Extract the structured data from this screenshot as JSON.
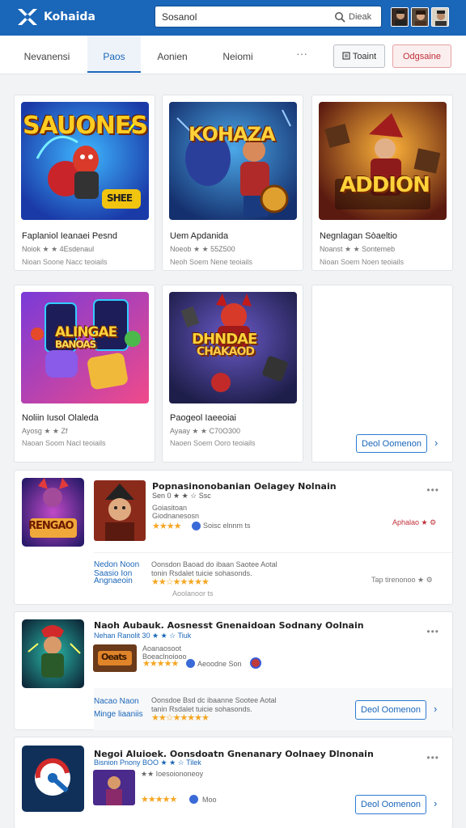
{
  "header": {
    "brand": "Kohaida",
    "search_value": "Sosanol",
    "search_button": "Dieak"
  },
  "nav": {
    "tabs": [
      "Nevanensi",
      "Paos",
      "Aonien",
      "Neiomi"
    ],
    "more": "···",
    "buttons": {
      "grey": "Toaint",
      "red": "Odgsaine"
    }
  },
  "grid": [
    {
      "art_title": "SAUONES",
      "art_badge": "SHEE",
      "title": "Faplaniol Ieanaei Pesnd",
      "meta": "Noiok  ★ ★  4Esdenaul",
      "meta2": "Nioan      Soone  Nacc  teoiails"
    },
    {
      "art_title": "KOHAZA",
      "title": "Uem Apdanida",
      "meta": "Noeob  ★ ★  55Z500",
      "meta2": "Neoh      Soem  Nene  teoiails"
    },
    {
      "art_title": "ADDION",
      "title": "Negnlagan Sòaeltio",
      "meta": "Noanst  ★ ★  Sontemeb",
      "meta2": "Nioan      Soem  Noen  teoiails"
    },
    {
      "art_title": "ALINGAE",
      "art_sub": "BANOAS",
      "title": "Noliin Iusol Olaleda",
      "meta": "Ayosg  ★ ★  Zf",
      "meta2": "Naoan      Soom  Nacl  teoiails"
    },
    {
      "art_title": "DHNDAE",
      "art_sub": "CHAKAOD",
      "title": "Paogeol Iaeeoiai",
      "meta": "Ayaay  ★ ★  C70O300",
      "meta2": "Naoen      Soem  Ooro  teoiails"
    },
    {
      "empty": true,
      "button": "Deol Oomenon",
      "chevron": "›"
    }
  ],
  "rows": [
    {
      "art_title": "RENGAO",
      "title": "Popnasinonobanian Oelagey Nolnain",
      "line1": "Sen  0  ★ ★  ☆ Ssc",
      "line2": "Goiasitoan",
      "line3": "Giodnanesosn",
      "stars": "★★★★",
      "stars_note": "Soisc  elnnm  ts",
      "side_link": "Aphalao  ★  ⚙",
      "lower_left_1": "Nedon  Noon",
      "lower_left_2": "Saasio  Ion",
      "lower_left_3": "Angnaeoin",
      "lower_desc": "Oonsdon  Baoad  do  ibaan  Saotee  Aotal",
      "lower_desc2": "tonin  Rsdalet  tuicie  sohasonds.",
      "lower_stars": "★★☆★★★★★",
      "lower_stars_note": "Aoolanoor  ts",
      "lower_right": "Tap  tirenonoo  ★  ⚙"
    },
    {
      "art_title": "",
      "title": "Naoh Aubauk. Aosnesst Gnenaidoan Sodnany Oolnain",
      "line1": "Nehan  Ranolit  30  ★ ★  ☆ Tiuk",
      "line2": "Aoanaosoot",
      "line3": "Boeaclnoiooo",
      "sub_art": "Oeats",
      "stars": "★★★★★",
      "stars_note": "Aeoodne  Son",
      "lower_left_1": "Nacao  Naon",
      "lower_left_2": "Minge  liaaniis",
      "lower_desc": "Oonsdoe  Bsd  dc  ibaanne  Sootee  Aotal",
      "lower_desc2": "tanin  Rsdalet  tuicie  sohasonds.",
      "lower_stars": "★★☆★★★★★",
      "button": "Deol Oomenon",
      "chevron": "›"
    },
    {
      "art_title": "",
      "title": "Negoi Aluioek. Oonsdoatn Gnenanary Oolnaey Dlnonain",
      "line1": "Bisnion  Pnony  BOO  ★ ★  ☆ Tilek",
      "line2": "★★  Ioesoiononeoy",
      "stars": "★★★★★",
      "stars_note": "Moo",
      "button": "Deol Oomenon",
      "chevron": "›"
    }
  ],
  "colors": {
    "brand": "#1a66b8",
    "accent_red": "#c0303a",
    "star": "#f5a623"
  }
}
